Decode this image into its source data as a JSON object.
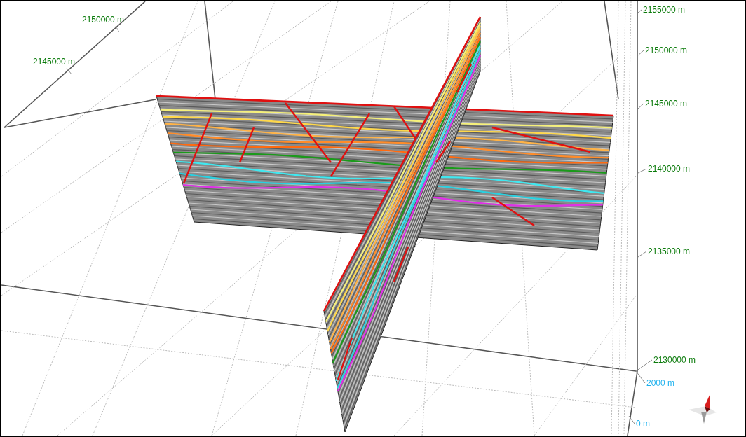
{
  "view": {
    "north_axis_labels": [
      "2150000 m",
      "2145000 m"
    ],
    "east_axis_labels": [
      "2155000 m",
      "2150000 m",
      "2145000 m",
      "2140000 m",
      "2135000 m",
      "2130000 m"
    ],
    "depth_axis_labels": [
      "2000 m",
      "0 m"
    ]
  }
}
